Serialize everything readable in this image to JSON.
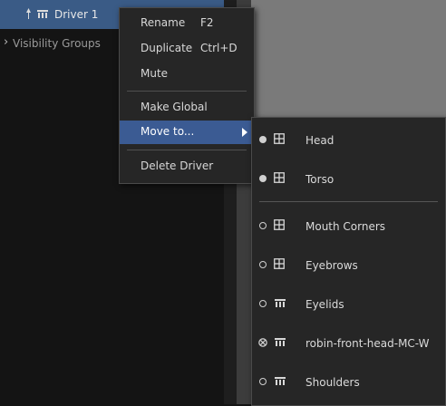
{
  "tree": {
    "driver_row": {
      "icons": [
        "pin-icon",
        "driver-icon"
      ],
      "label": "Driver 1"
    },
    "visibility_row": {
      "expander": "›",
      "label": "Visibility Groups"
    }
  },
  "context_menu": {
    "rename": {
      "label": "Rename",
      "shortcut": "F2"
    },
    "duplicate": {
      "label": "Duplicate",
      "shortcut": "Ctrl+D"
    },
    "mute": {
      "label": "Mute"
    },
    "make_global": {
      "label": "Make Global"
    },
    "move_to": {
      "label": "Move to..."
    },
    "delete": {
      "label": "Delete Driver"
    }
  },
  "submenu": {
    "items": [
      {
        "label": "Head",
        "radio": "filled",
        "icon": "group-icon"
      },
      {
        "label": "Torso",
        "radio": "filled",
        "icon": "group-icon"
      },
      {
        "label": "Mouth Corners",
        "radio": "open",
        "icon": "group-icon"
      },
      {
        "label": "Eyebrows",
        "radio": "open",
        "icon": "group-icon"
      },
      {
        "label": "Eyelids",
        "radio": "open",
        "icon": "driver-icon"
      },
      {
        "label": "robin-front-head-MC-W",
        "radio": "crossed",
        "icon": "driver-icon"
      },
      {
        "label": "Shoulders",
        "radio": "open",
        "icon": "driver-icon"
      }
    ]
  },
  "colors": {
    "selection": "#3a5b86",
    "menu_highlight": "#3b5b93",
    "menu_bg": "#262626",
    "panel_bg": "#141414",
    "viewport_bg": "#7a7a7a"
  }
}
